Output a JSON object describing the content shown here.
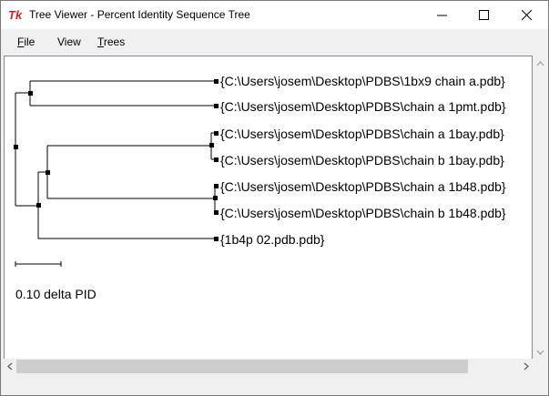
{
  "window": {
    "title": "Tree Viewer - Percent Identity Sequence Tree",
    "app_icon": "tk-feather-icon"
  },
  "menubar": {
    "items": [
      {
        "label": "File",
        "underline": "F"
      },
      {
        "label": "View",
        "underline": ""
      },
      {
        "label": "Trees",
        "underline": "T"
      }
    ]
  },
  "tree": {
    "leaves": [
      "{C:\\Users\\josem\\Desktop\\PDBS\\1bx9 chain a.pdb}",
      "{C:\\Users\\josem\\Desktop\\PDBS\\chain a 1pmt.pdb}",
      "{C:\\Users\\josem\\Desktop\\PDBS\\chain a 1bay.pdb}",
      "{C:\\Users\\josem\\Desktop\\PDBS\\chain b 1bay.pdb}",
      "{C:\\Users\\josem\\Desktop\\PDBS\\chain a 1b48.pdb}",
      "{C:\\Users\\josem\\Desktop\\PDBS\\chain b 1b48.pdb}",
      "{1b4p 02.pdb.pdb}"
    ],
    "scale_label": "0.10 delta PID"
  },
  "colors": {
    "line": "#000000",
    "canvas": "#ffffff"
  }
}
